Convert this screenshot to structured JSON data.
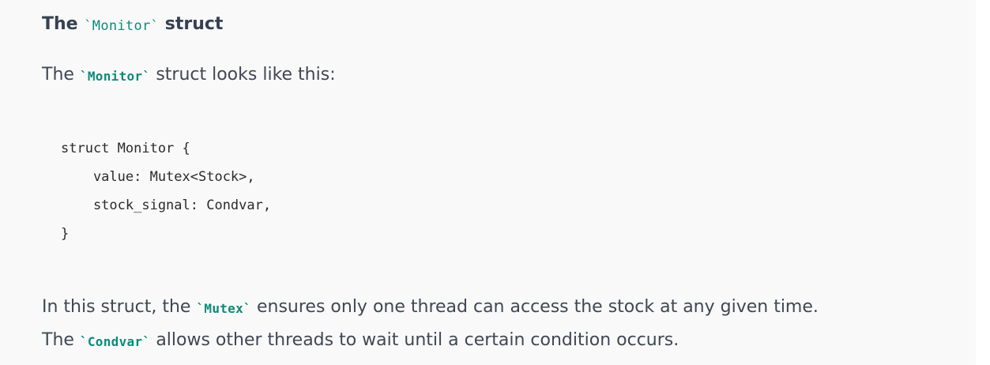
{
  "heading": {
    "prefix": "The ",
    "code": "`Monitor`",
    "suffix": " struct"
  },
  "intro": {
    "prefix": "The ",
    "code": "`Monitor`",
    "suffix": " struct looks like this:"
  },
  "code_block": {
    "lines": [
      "struct Monitor {",
      "    value: Mutex<Stock>,",
      "    stock_signal: Condvar,",
      "}"
    ]
  },
  "paragraph_mutex": {
    "prefix": "In this struct, the ",
    "code": "`Mutex`",
    "suffix": " ensures only one thread can access the stock at any given time."
  },
  "paragraph_condvar": {
    "prefix": "The ",
    "code": "`Condvar`",
    "suffix": " allows other threads to wait until a certain condition occurs."
  }
}
